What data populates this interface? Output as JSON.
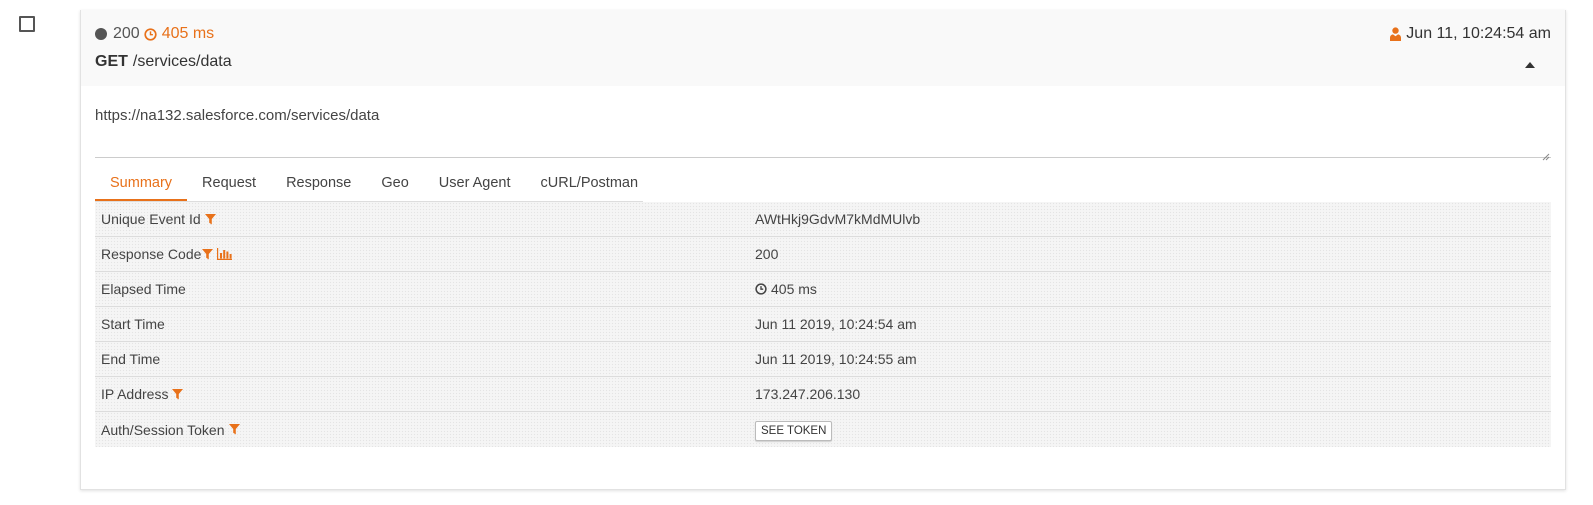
{
  "event": {
    "status_code": "200",
    "elapsed": "405 ms",
    "method": "GET",
    "path": "/services/data",
    "timestamp": "Jun 11, 10:24:54 am",
    "url": "https://na132.salesforce.com/services/data"
  },
  "tabs": [
    {
      "label": "Summary",
      "active": true
    },
    {
      "label": "Request",
      "active": false
    },
    {
      "label": "Response",
      "active": false
    },
    {
      "label": "Geo",
      "active": false
    },
    {
      "label": "User Agent",
      "active": false
    },
    {
      "label": "cURL/Postman",
      "active": false
    }
  ],
  "summary": {
    "rows": [
      {
        "label": "Unique Event Id",
        "value": "AWtHkj9GdvM7kMdMUlvb",
        "icons": [
          "filter-icon"
        ]
      },
      {
        "label": "Response Code",
        "value": "200",
        "icons": [
          "filter-icon",
          "bar-chart-icon"
        ]
      },
      {
        "label": "Elapsed Time",
        "value": "405 ms",
        "value_icon": "clock-icon"
      },
      {
        "label": "Start Time",
        "value": "Jun 11 2019, 10:24:54 am"
      },
      {
        "label": "End Time",
        "value": "Jun 11 2019, 10:24:55 am"
      },
      {
        "label": "IP Address",
        "value": "173.247.206.130",
        "icons": [
          "filter-icon"
        ]
      },
      {
        "label": "Auth/Session Token",
        "button": "SEE TOKEN",
        "icons": [
          "filter-icon"
        ]
      }
    ]
  },
  "colors": {
    "accent": "#e8711a",
    "status_dot": "#555555"
  }
}
